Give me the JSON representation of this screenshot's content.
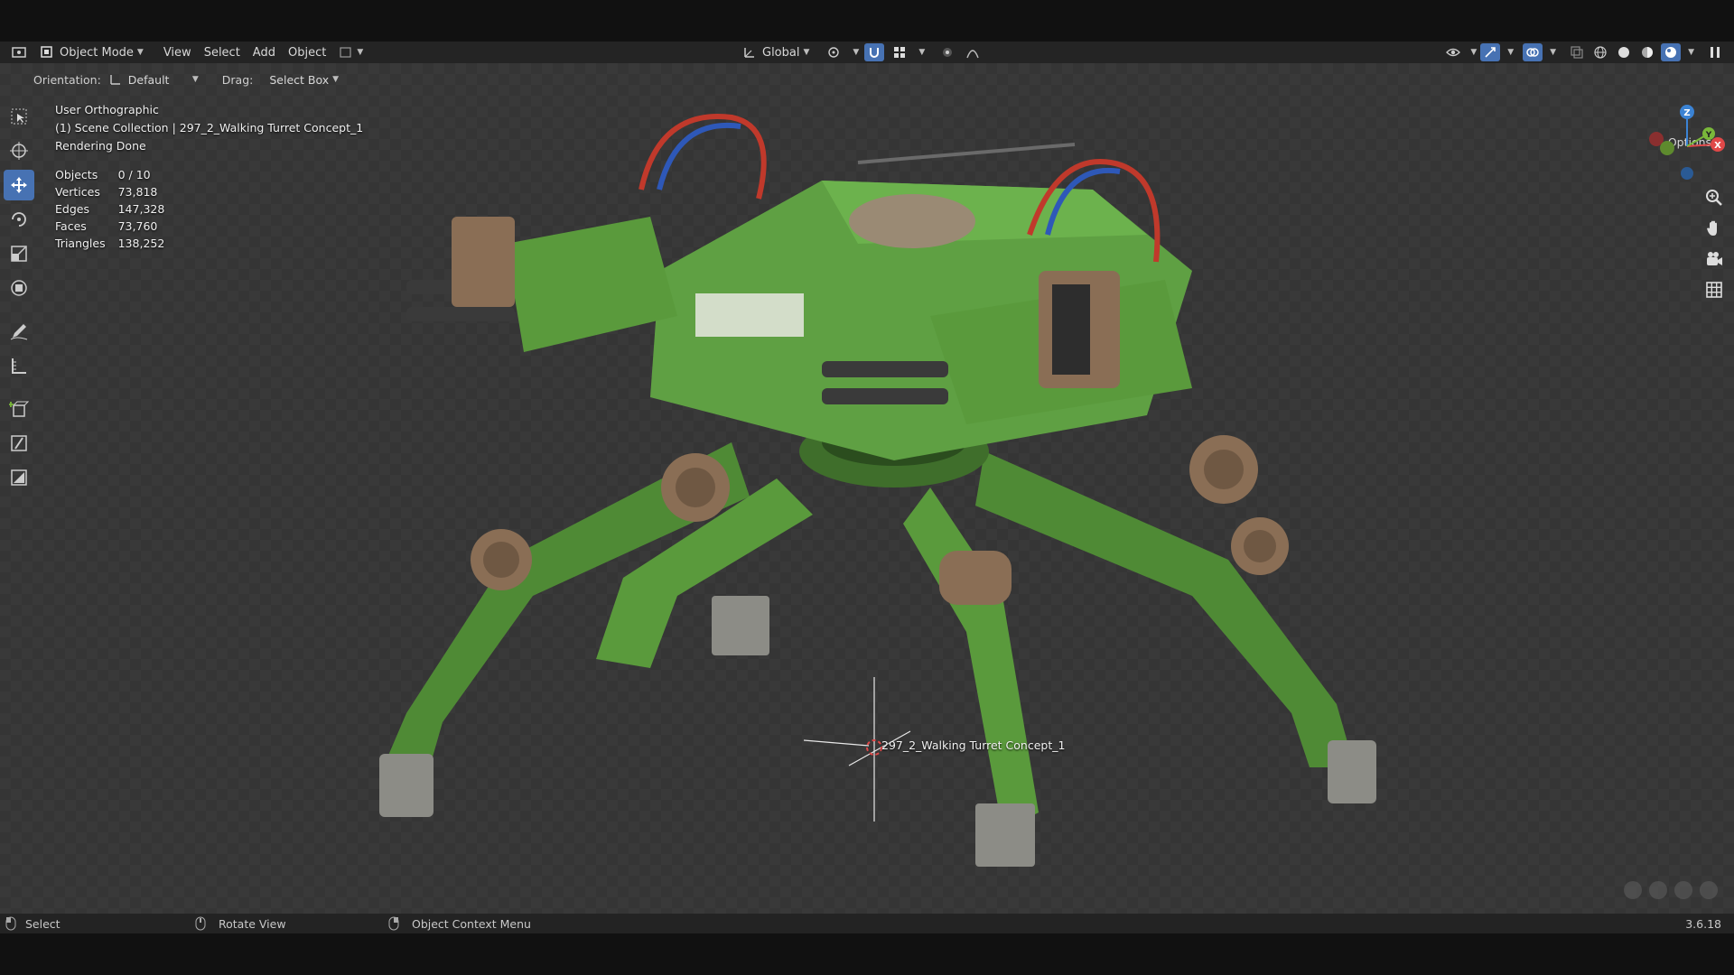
{
  "header": {
    "mode_label": "Object Mode",
    "menus": [
      "View",
      "Select",
      "Add",
      "Object"
    ],
    "transform_orientation": "Global"
  },
  "tool_settings": {
    "orientation_label": "Orientation:",
    "orientation_value": "Default",
    "drag_label": "Drag:",
    "drag_value": "Select Box",
    "options_label": "Options"
  },
  "viewport": {
    "view_name": "User Orthographic",
    "collection_line": "(1) Scene Collection | 297_2_Walking Turret Concept_1",
    "render_status": "Rendering Done",
    "origin_label": "297_2_Walking Turret Concept_1"
  },
  "stats": [
    {
      "label": "Objects",
      "value": "0 / 10"
    },
    {
      "label": "Vertices",
      "value": "73,818"
    },
    {
      "label": "Edges",
      "value": "147,328"
    },
    {
      "label": "Faces",
      "value": "73,760"
    },
    {
      "label": "Triangles",
      "value": "138,252"
    }
  ],
  "gizmo": {
    "axes": [
      "Z",
      "Y",
      "X"
    ],
    "colors": {
      "x": "#e04848",
      "y": "#7ab83a",
      "z": "#3b83d4"
    }
  },
  "statusbar": {
    "select": "Select",
    "rotate": "Rotate View",
    "context_menu": "Object Context Menu",
    "version": "3.6.18"
  },
  "colors": {
    "accent": "#4772b3",
    "robot_green": "#5a9a3c",
    "robot_brown": "#8a6e55"
  }
}
